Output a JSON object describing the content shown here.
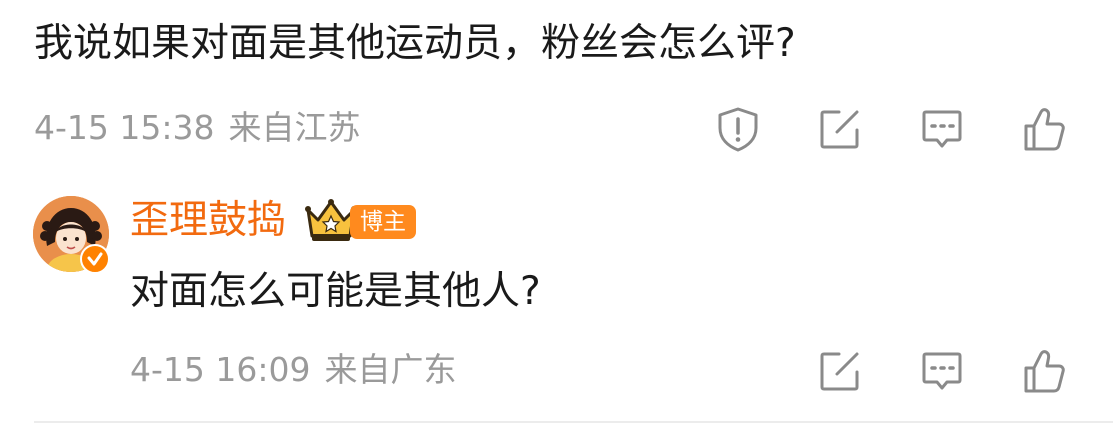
{
  "parent_comment": {
    "text": "我说如果对面是其他运动员，粉丝会怎么评?",
    "time": "4-15 15:38",
    "location": "来自江苏",
    "actions": [
      "report-icon",
      "edit-icon",
      "comment-icon",
      "like-icon"
    ]
  },
  "reply": {
    "username": "歪理鼓捣",
    "author_badge": "博主",
    "text": "对面怎么可能是其他人?",
    "time": "4-15 16:09",
    "location": "来自广东",
    "actions": [
      "edit-icon",
      "comment-icon",
      "like-icon"
    ]
  },
  "colors": {
    "text_primary": "#1a1a1a",
    "text_meta": "#9a9a9a",
    "username": "#f26a0f",
    "badge_bg": "#ff8a1e",
    "verified": "#ff8200",
    "icon_stroke": "#8a8a8a"
  }
}
